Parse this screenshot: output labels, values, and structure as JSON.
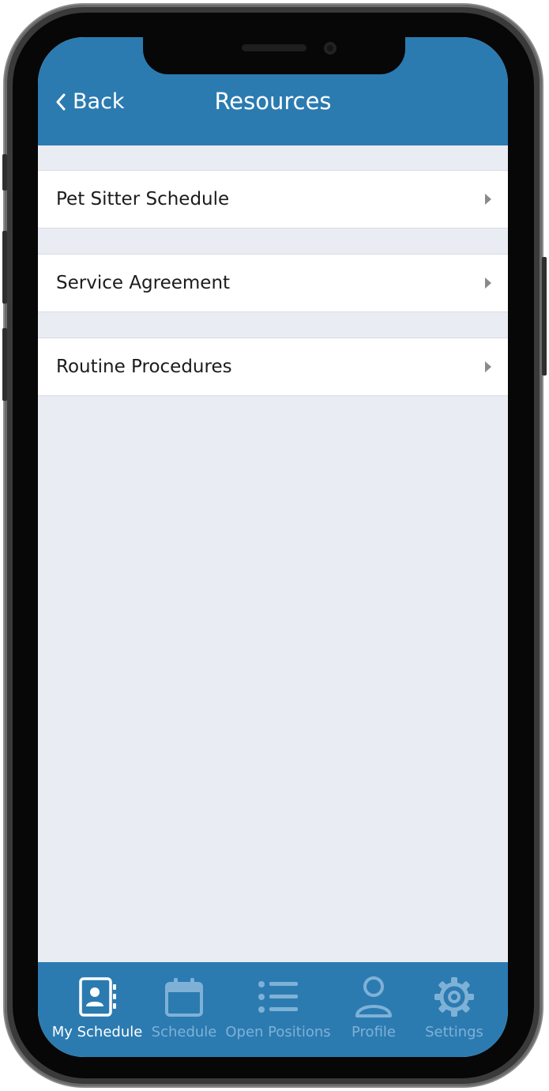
{
  "header": {
    "back_label": "Back",
    "title": "Resources"
  },
  "resources": {
    "items": [
      {
        "label": "Pet Sitter Schedule"
      },
      {
        "label": "Service Agreement"
      },
      {
        "label": "Routine Procedures"
      }
    ]
  },
  "tabbar": {
    "tabs": [
      {
        "label": "My Schedule",
        "icon": "contact-book-icon",
        "active": true
      },
      {
        "label": "Schedule",
        "icon": "calendar-icon",
        "active": false
      },
      {
        "label": "Open Positions",
        "icon": "list-icon",
        "active": false
      },
      {
        "label": "Profile",
        "icon": "person-icon",
        "active": false
      },
      {
        "label": "Settings",
        "icon": "gear-icon",
        "active": false
      }
    ]
  },
  "colors": {
    "brand_blue": "#2b7bb1",
    "background": "#e9ecf3",
    "inactive_tab": "#7fb1d6",
    "list_arrow": "#8a8a8a"
  }
}
